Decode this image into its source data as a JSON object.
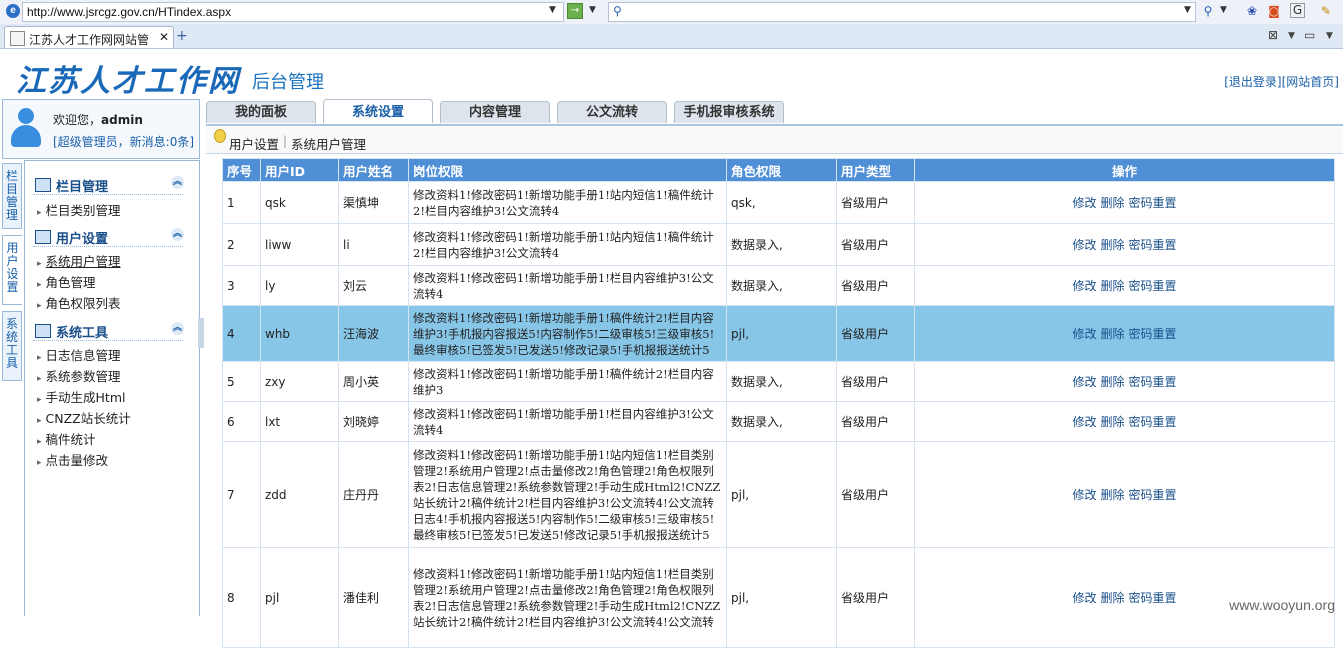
{
  "browser": {
    "url": "http://www.jsrcgz.gov.cn/HTindex.aspx",
    "tab_title": "江苏人才工作网网站管"
  },
  "header": {
    "logo": "江苏人才工作网",
    "subtitle": "后台管理",
    "logout": "[退出登录]",
    "site_home": "[网站首页]"
  },
  "user": {
    "welcome_prefix": "欢迎您，",
    "username": "admin",
    "role_line": "[超级管理员，新消息:0条]"
  },
  "side_tabs": [
    "栏目管理",
    "用户设置",
    "系统工具"
  ],
  "nav": {
    "groups": [
      {
        "title": "栏目管理",
        "items": [
          "栏目类别管理"
        ]
      },
      {
        "title": "用户设置",
        "items": [
          "系统用户管理",
          "角色管理",
          "角色权限列表"
        ]
      },
      {
        "title": "系统工具",
        "items": [
          "日志信息管理",
          "系统参数管理",
          "手动生成Html",
          "CNZZ站长统计",
          "稿件统计",
          "点击量修改"
        ]
      }
    ]
  },
  "top_tabs": [
    "我的面板",
    "系统设置",
    "内容管理",
    "公文流转",
    "手机报审核系统"
  ],
  "breadcrumb": {
    "parent": "用户设置",
    "current": "系统用户管理"
  },
  "table": {
    "headers": [
      "序号",
      "用户ID",
      "用户姓名",
      "岗位权限",
      "角色权限",
      "用户类型",
      "操作"
    ],
    "actions": [
      "修改",
      "删除",
      "密码重置"
    ],
    "rows": [
      {
        "no": "1",
        "id": "qsk",
        "name": "渠慎坤",
        "perm": "修改资料1!修改密码1!新增功能手册1!站内短信1!稿件统计2!栏目内容维护3!公文流转4",
        "role": "qsk,",
        "type": "省级用户"
      },
      {
        "no": "2",
        "id": "liww",
        "name": "li",
        "perm": "修改资料1!修改密码1!新增功能手册1!站内短信1!稿件统计2!栏目内容维护3!公文流转4",
        "role": "数据录入,",
        "type": "省级用户"
      },
      {
        "no": "3",
        "id": "ly",
        "name": "刘云",
        "perm": "修改资料1!修改密码1!新增功能手册1!栏目内容维护3!公文流转4",
        "role": "数据录入,",
        "type": "省级用户"
      },
      {
        "no": "4",
        "id": "whb",
        "name": "汪海波",
        "perm": "修改资料1!修改密码1!新增功能手册1!稿件统计2!栏目内容维护3!手机报内容报送5!内容制作5!二级审核5!三级审核5!最终审核5!已签发5!已发送5!修改记录5!手机报报送统计5",
        "role": "pjl,",
        "type": "省级用户"
      },
      {
        "no": "5",
        "id": "zxy",
        "name": "周小英",
        "perm": "修改资料1!修改密码1!新增功能手册1!稿件统计2!栏目内容维护3",
        "role": "数据录入,",
        "type": "省级用户"
      },
      {
        "no": "6",
        "id": "lxt",
        "name": "刘晓婷",
        "perm": "修改资料1!修改密码1!新增功能手册1!栏目内容维护3!公文流转4",
        "role": "数据录入,",
        "type": "省级用户"
      },
      {
        "no": "7",
        "id": "zdd",
        "name": "庄丹丹",
        "perm": "修改资料1!修改密码1!新增功能手册1!站内短信1!栏目类别管理2!系统用户管理2!点击量修改2!角色管理2!角色权限列表2!日志信息管理2!系统参数管理2!手动生成Html2!CNZZ站长统计2!稿件统计2!栏目内容维护3!公文流转4!公文流转日志4!手机报内容报送5!内容制作5!二级审核5!三级审核5!最终审核5!已签发5!已发送5!修改记录5!手机报报送统计5",
        "role": "pjl,",
        "type": "省级用户"
      },
      {
        "no": "8",
        "id": "pjl",
        "name": "潘佳利",
        "perm": "修改资料1!修改密码1!新增功能手册1!站内短信1!栏目类别管理2!系统用户管理2!点击量修改2!角色管理2!角色权限列表2!日志信息管理2!系统参数管理2!手动生成Html2!CNZZ站长统计2!稿件统计2!栏目内容维护3!公文流转4!公文流转",
        "role": "pjl,",
        "type": "省级用户"
      }
    ],
    "highlighted_row": 4
  },
  "watermark": "www.wooyun.org",
  "colors": {
    "header_bg": "#4f8fd6",
    "highlight_row": "#88c6e8",
    "link": "#1a5fa8"
  }
}
